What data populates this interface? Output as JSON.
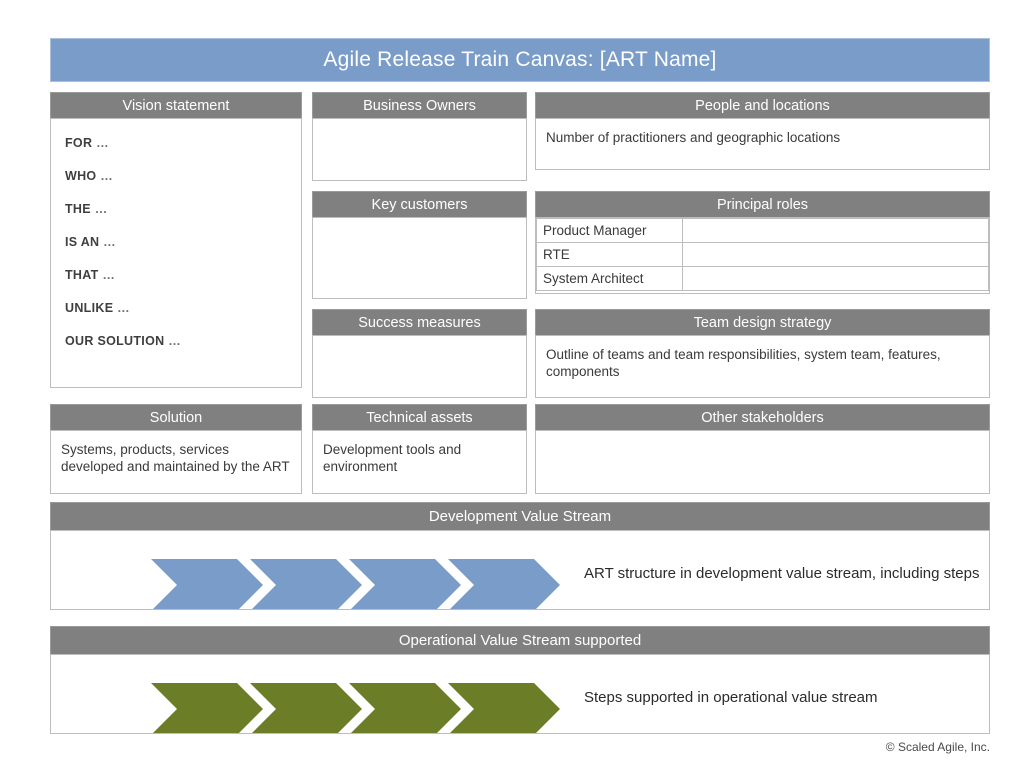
{
  "header": {
    "title": "Agile Release Train Canvas: [ART Name]"
  },
  "panels": {
    "vision_statement": {
      "title": "Vision statement",
      "lines": [
        "FOR",
        "WHO",
        "THE",
        "IS AN",
        "THAT",
        "UNLIKE",
        "OUR SOLUTION"
      ],
      "ellipsis": "…"
    },
    "business_owners": {
      "title": "Business Owners",
      "body": ""
    },
    "key_customers": {
      "title": "Key customers",
      "body": ""
    },
    "success_measures": {
      "title": "Success measures",
      "body": ""
    },
    "people_and_locations": {
      "title": "People and locations",
      "body": "Number of practitioners and geographic locations"
    },
    "principal_roles": {
      "title": "Principal roles",
      "rows": [
        {
          "role": "Product Manager",
          "value": ""
        },
        {
          "role": "RTE",
          "value": ""
        },
        {
          "role": "System Architect",
          "value": ""
        }
      ]
    },
    "team_design_strategy": {
      "title": "Team design strategy",
      "body": "Outline of teams and team responsibilities, system team, features, components"
    },
    "solution": {
      "title": "Solution",
      "body": "Systems, products, services developed and maintained by the ART"
    },
    "technical_assets": {
      "title": "Technical assets",
      "body": "Development tools and environment"
    },
    "other_stakeholders": {
      "title": "Other stakeholders",
      "body": ""
    },
    "development_value_stream": {
      "title": "Development Value Stream",
      "caption": "ART structure in development value stream, including steps",
      "step_count": 4,
      "chevron_color": "#7a9cc9"
    },
    "operational_value_stream": {
      "title": "Operational Value Stream supported",
      "caption": "Steps supported in operational value stream",
      "step_count": 4,
      "chevron_color": "#6b7d27"
    }
  },
  "footer": {
    "copyright": "© Scaled Agile, Inc."
  },
  "colors": {
    "title_bar": "#7a9cc9",
    "panel_header": "#808080",
    "panel_border": "#bdbdbd",
    "development_chevron": "#7a9cc9",
    "operational_chevron": "#6b7d27",
    "page_background": "#ffffff"
  }
}
